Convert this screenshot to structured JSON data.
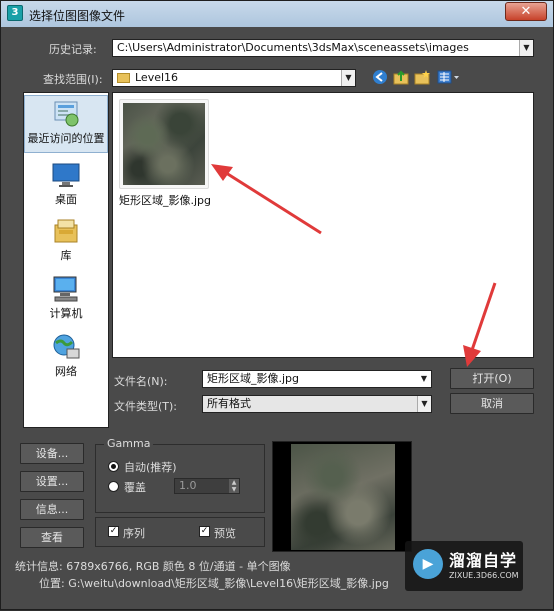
{
  "window": {
    "title": "选择位图图像文件",
    "app_icon_glyph": "3",
    "close_glyph": "✕"
  },
  "history": {
    "label": "历史记录:",
    "value": "C:\\Users\\Administrator\\Documents\\3dsMax\\sceneassets\\images"
  },
  "lookin": {
    "label": "查找范围(I):",
    "value": "Level16",
    "tools": [
      "back-icon",
      "up-folder-icon",
      "new-folder-icon",
      "view-menu-icon"
    ]
  },
  "places": [
    {
      "label": "最近访问的位置",
      "icon": "recent-places-icon",
      "active": true
    },
    {
      "label": "桌面",
      "icon": "desktop-icon",
      "active": false
    },
    {
      "label": "库",
      "icon": "library-icon",
      "active": false
    },
    {
      "label": "计算机",
      "icon": "computer-icon",
      "active": false
    },
    {
      "label": "网络",
      "icon": "network-icon",
      "active": false
    }
  ],
  "files": [
    {
      "name": "矩形区域_影像.jpg"
    }
  ],
  "filename": {
    "label": "文件名(N):",
    "value": "矩形区域_影像.jpg"
  },
  "filetype": {
    "label": "文件类型(T):",
    "value": "所有格式"
  },
  "buttons": {
    "open": "打开(O)",
    "cancel": "取消",
    "setup1": "设备...",
    "setup2": "设置...",
    "info": "信息...",
    "view": "查看"
  },
  "gamma": {
    "title": "Gamma",
    "auto_label": "自动(推荐)",
    "override_label": "覆盖",
    "override_value": "1.0"
  },
  "options": {
    "sequence_label": "序列",
    "preview_label": "预览"
  },
  "status": {
    "stats": "统计信息: 6789x6766, RGB 颜色 8 位/通道 - 单个图像",
    "location": "位置: G:\\weitu\\download\\矩形区域_影像\\Level16\\矩形区域_影像.jpg"
  },
  "watermark": {
    "brand": "溜溜自学",
    "site": "ZIXUE.3D66.COM"
  },
  "colors": {
    "arrow": "#e03a3a",
    "dialog_bg": "#4a4a4a"
  }
}
